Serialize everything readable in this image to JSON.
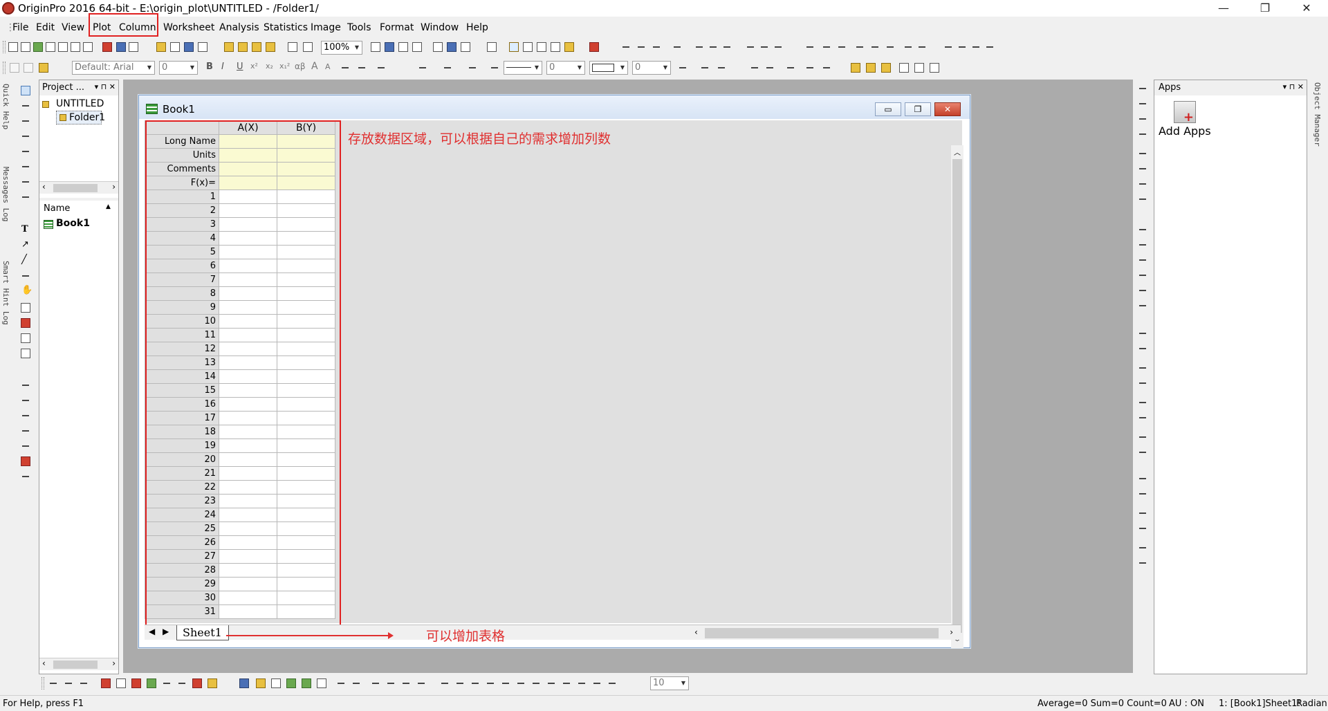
{
  "window": {
    "title": "OriginPro 2016 64-bit - E:\\origin_plot\\UNTITLED - /Folder1/",
    "minimize": "—",
    "restore": "❐",
    "close": "✕"
  },
  "menu": [
    "File",
    "Edit",
    "View",
    "Plot",
    "Column",
    "Worksheet",
    "Analysis",
    "Statistics",
    "Image",
    "Tools",
    "Format",
    "Window",
    "Help"
  ],
  "toolbar": {
    "zoom": "100%",
    "font": "Default: Arial",
    "font_size": "0",
    "line_width": "0",
    "fill_value": "0",
    "bottom_combo": "10",
    "format_buttons": [
      "B",
      "I",
      "U",
      "x²",
      "x₂",
      "x₁²",
      "αβ",
      "A",
      "A"
    ]
  },
  "side_tabs": [
    "Quick Help",
    "Messages Log",
    "Smart Hint Log"
  ],
  "project_explorer": {
    "title": "Project ...",
    "tree": [
      "UNTITLED",
      "Folder1"
    ],
    "list_header": "Name",
    "items": [
      "Book1"
    ]
  },
  "book": {
    "title": "Book1",
    "columns": [
      "A(X)",
      "B(Y)"
    ],
    "meta_rows": [
      "Long Name",
      "Units",
      "Comments",
      "F(x)="
    ],
    "rows": [
      "1",
      "2",
      "3",
      "4",
      "5",
      "6",
      "7",
      "8",
      "9",
      "10",
      "11",
      "12",
      "13",
      "14",
      "15",
      "16",
      "17",
      "18",
      "19",
      "20",
      "21",
      "22",
      "23",
      "24",
      "25",
      "26",
      "27",
      "28",
      "29",
      "30",
      "31"
    ],
    "sheet": "Sheet1"
  },
  "annotations": {
    "data_area": "存放数据区域，可以根据自己的需求增加列数",
    "add_sheet": "可以增加表格"
  },
  "apps_panel": {
    "title": "Apps",
    "item": "Add Apps"
  },
  "object_manager": "Object Manager",
  "status": {
    "help": "For Help, press F1",
    "stats": "Average=0 Sum=0 Count=0",
    "au": "AU : ON",
    "location": "1: [Book1]Sheet1!",
    "angle": "Radian"
  },
  "colors": {
    "annotation": "#e03030",
    "meta_cell": "#fafad2",
    "workspace": "#ababab"
  }
}
